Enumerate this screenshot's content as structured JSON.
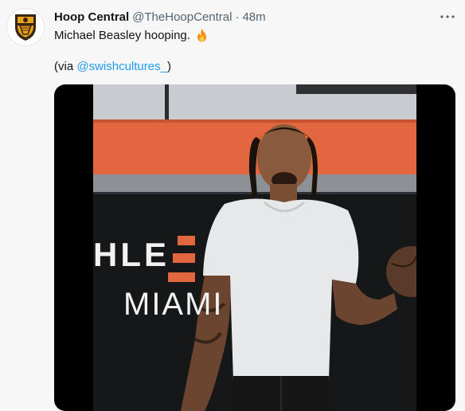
{
  "tweet": {
    "display_name": "Hoop Central",
    "handle": "@TheHoopCentral",
    "separator": "·",
    "time": "48m",
    "text": "Michael Beasley hooping.",
    "emoji_icon": "fire-icon",
    "via_prefix": "(via ",
    "via_mention": "@swishcultures_",
    "via_suffix": ")"
  },
  "media": {
    "wall_text_top": "HLE",
    "wall_text_bottom": "MIAMI"
  },
  "colors": {
    "link": "#1d9bf0",
    "secondary": "#536471",
    "wall_orange": "#e2673e"
  }
}
